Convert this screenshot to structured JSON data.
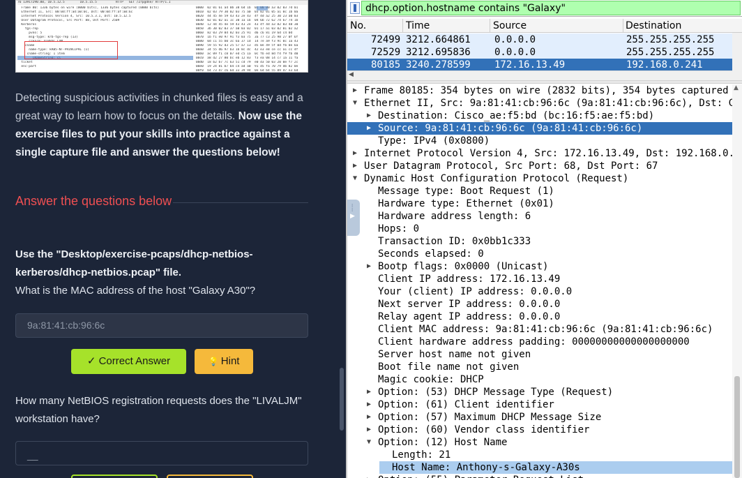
{
  "lesson": {
    "paragraph_plain": "Detecting suspicious activities in chunked files is easy and a great way to learn how to focus on the details.",
    "paragraph_bold": "Now use the exercise files to put your skills into practice against a single capture file and answer the questions below!",
    "questions_heading": "Answer the questions below",
    "q1_bold": "Use the \"Desktop/exercise-pcaps/dhcp-netbios-kerberos/dhcp-netbios.pcap\" file.",
    "q1_text": "What is the MAC address of the host \"Galaxy A30\"?",
    "q1_answer": "9a:81:41:cb:96:6c",
    "correct_label": "Correct Answer",
    "hint_label": "Hint",
    "q2_text": "How many NetBIOS registration requests does the \"LIVALJM\" workstation have?",
    "q2_placeholder": "__",
    "accent_red": "#ef4f52",
    "accent_green": "#a6e22a",
    "accent_yellow": "#f5b93b"
  },
  "thumbnail": {
    "line1": "76 13917290.00, 10.5.12.5        10.5.15.5          HTTP   GET /Zrpgdne/ HTTP/1.1",
    "tree": [
      "  Frame 80: 1336 bytes on wire (0000 bits), 1336 bytes captured (0000 bits)",
      "  Ethernet II, Src: 00:0d:ff:ad:a0:0c, Dst: 00:0d:ff:af:a0:6c",
      "  Internet Protocol Version 4, Src: 10.5.3.1, Dst: 10.5.12.5",
      "  User Datagram Protocol, Src Port: 88, Dst Port: 2509",
      "  Kerberos",
      "    tgs-rep",
      "      pvno: 5",
      "      msg-type: krb-tgs-rep (13)",
      "      crealm: DIRVOC.COM",
      "    cname",
      "      name-type: kRB5-NT-PRINCIPAL (1)",
      "     cname-string: 1 item",
      "        CNameString: cl",
      "  ticket",
      "  enc-part"
    ],
    "hex": [
      "0000  02 01 61 a4 0b 38 6d 1b  02 00 00 a3 02 03 7d 01",
      "0010  02 03 79 30 02 03 75 a0  03 02 01 05 a1 0c 1b 0a",
      "0020  44 45 4e 59 43 43 2e 43  4f 4d a2 25 30 23 a0 03",
      "0030  02 01 02 a1 1c 30 1a 1b  04 6b 72 62 74 67 74 1b",
      "0040  12 44 45 4e 59 43 43 2e  43 4f 4d a3 82 03 48 30",
      "0050  3b 30 02 03 37 a0 03 02  01 17 a1 03 02 01 02 a2",
      "0060  82 03 29 04 82 03 25 91  d6 c6 81 19 6d c4 0d",
      "0070  1b f1 e0 97 91 f3 03 75  3a 77 c3 25 98 27 0f 6f",
      "0080  0d c1 55 b0 3c 6a 37 1d  14 7e a9 f3 9c 0c 1a 43",
      "0090  59 55 92 d3 25 57 a7 13  d5 0e 49 5f 0d fb 0e 6a",
      "00a0  34 55 d6 97 b3 1b 8c dc  42 e3 e8 ce cc a1 cc 4f",
      "00b0  ac 09 f1 c8 07 ed c5 1a  0c fb ed 8d f4 f9 fb d0",
      "00c0  a8 d2 27 80 bc eb 12 83  f3 ea 08 14 c7 1a 11 fa",
      "00d0  18 b2 b7 7c 63 51 cd 79  e0 d3 50 03 20 0e f7 2c",
      "00e0  19 24 81 b7 b4 c4 a4 a0  91 d5 fa 70 79 db 82 0e",
      "00f0  b4 73 d7 c6 6d 33 39 94  0e 6d b4 55 09 d7 e3 6d",
      "0100  49 f6 8c 54 b1 1a 5f 8b  33 36 a8 63 22 47 00 23"
    ]
  },
  "wireshark": {
    "filter": "dhcp.option.hostname contains \"Galaxy\"",
    "columns": [
      "No.",
      "Time",
      "Source",
      "Destination"
    ],
    "packets": [
      {
        "no": "72499",
        "time": "3212.664861",
        "src": "0.0.0.0",
        "dst": "255.255.255.255"
      },
      {
        "no": "72529",
        "time": "3212.695836",
        "src": "0.0.0.0",
        "dst": "255.255.255.255"
      },
      {
        "no": "80185",
        "time": "3240.278599",
        "src": "172.16.13.49",
        "dst": "192.168.0.241"
      }
    ],
    "selected_packet": "80185",
    "tree": [
      {
        "lvl": 0,
        "arrow": "right",
        "text": "Frame 80185: 354 bytes on wire (2832 bits), 354 bytes captured (2832 bits)"
      },
      {
        "lvl": 0,
        "arrow": "down",
        "text": "Ethernet II, Src: 9a:81:41:cb:96:6c (9a:81:41:cb:96:6c), Dst: Cisco_ae:f5:bd (bc:16:f5:ae:f5:bd)"
      },
      {
        "lvl": 1,
        "arrow": "right",
        "text": "Destination: Cisco_ae:f5:bd (bc:16:f5:ae:f5:bd)"
      },
      {
        "lvl": 1,
        "arrow": "right",
        "text": "Source: 9a:81:41:cb:96:6c (9a:81:41:cb:96:6c)",
        "state": "selected"
      },
      {
        "lvl": 1,
        "arrow": "",
        "text": "Type: IPv4 (0x0800)"
      },
      {
        "lvl": 0,
        "arrow": "right",
        "text": "Internet Protocol Version 4, Src: 172.16.13.49, Dst: 192.168.0.241"
      },
      {
        "lvl": 0,
        "arrow": "right",
        "text": "User Datagram Protocol, Src Port: 68, Dst Port: 67"
      },
      {
        "lvl": 0,
        "arrow": "down",
        "text": "Dynamic Host Configuration Protocol (Request)"
      },
      {
        "lvl": 1,
        "arrow": "",
        "text": "Message type: Boot Request (1)"
      },
      {
        "lvl": 1,
        "arrow": "",
        "text": "Hardware type: Ethernet (0x01)"
      },
      {
        "lvl": 1,
        "arrow": "",
        "text": "Hardware address length: 6"
      },
      {
        "lvl": 1,
        "arrow": "",
        "text": "Hops: 0"
      },
      {
        "lvl": 1,
        "arrow": "",
        "text": "Transaction ID: 0x0bb1c333"
      },
      {
        "lvl": 1,
        "arrow": "",
        "text": "Seconds elapsed: 0"
      },
      {
        "lvl": 1,
        "arrow": "right",
        "text": "Bootp flags: 0x0000 (Unicast)"
      },
      {
        "lvl": 1,
        "arrow": "",
        "text": "Client IP address: 172.16.13.49"
      },
      {
        "lvl": 1,
        "arrow": "",
        "text": "Your (client) IP address: 0.0.0.0"
      },
      {
        "lvl": 1,
        "arrow": "",
        "text": "Next server IP address: 0.0.0.0"
      },
      {
        "lvl": 1,
        "arrow": "",
        "text": "Relay agent IP address: 0.0.0.0"
      },
      {
        "lvl": 1,
        "arrow": "",
        "text": "Client MAC address: 9a:81:41:cb:96:6c (9a:81:41:cb:96:6c)"
      },
      {
        "lvl": 1,
        "arrow": "",
        "text": "Client hardware address padding: 00000000000000000000"
      },
      {
        "lvl": 1,
        "arrow": "",
        "text": "Server host name not given"
      },
      {
        "lvl": 1,
        "arrow": "",
        "text": "Boot file name not given"
      },
      {
        "lvl": 1,
        "arrow": "",
        "text": "Magic cookie: DHCP"
      },
      {
        "lvl": 1,
        "arrow": "right",
        "text": "Option: (53) DHCP Message Type (Request)"
      },
      {
        "lvl": 1,
        "arrow": "right",
        "text": "Option: (61) Client identifier"
      },
      {
        "lvl": 1,
        "arrow": "right",
        "text": "Option: (57) Maximum DHCP Message Size"
      },
      {
        "lvl": 1,
        "arrow": "right",
        "text": "Option: (60) Vendor class identifier"
      },
      {
        "lvl": 1,
        "arrow": "down",
        "text": "Option: (12) Host Name"
      },
      {
        "lvl": 2,
        "arrow": "",
        "text": "Length: 21"
      },
      {
        "lvl": 2,
        "arrow": "",
        "text": "Host Name: Anthony-s-Galaxy-A30s",
        "state": "highlight"
      },
      {
        "lvl": 1,
        "arrow": "right",
        "text": "Option: (55) Parameter Request List"
      }
    ]
  }
}
